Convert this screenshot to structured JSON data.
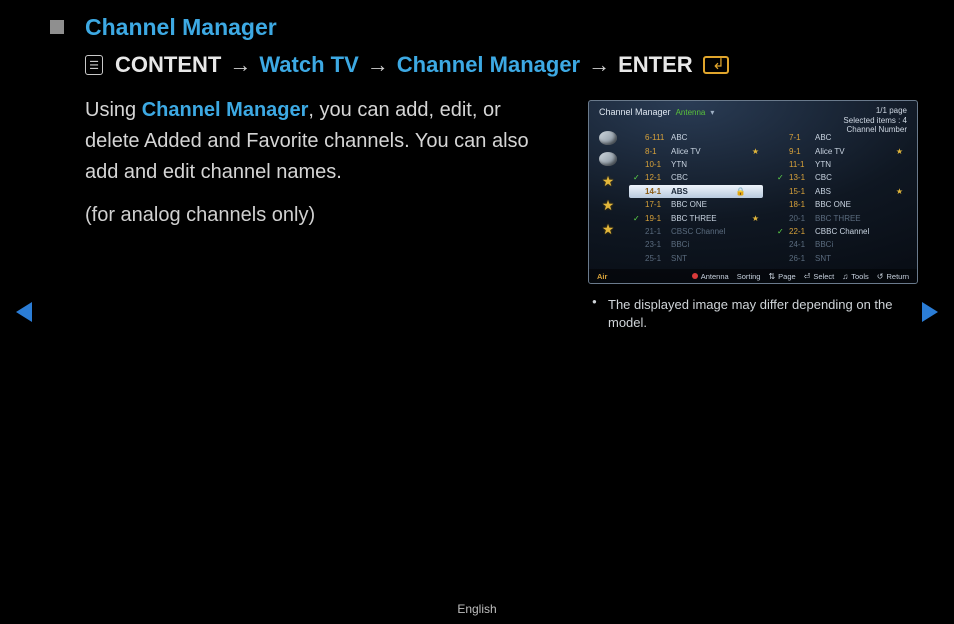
{
  "title": "Channel Manager",
  "breadcrumb": {
    "content": "CONTENT",
    "watch_tv": "Watch TV",
    "channel_manager": "Channel Manager",
    "enter": "ENTER",
    "arrow": "→"
  },
  "body": {
    "pre": "Using ",
    "cm": "Channel Manager",
    "post": ", you can add, edit, or delete Added and Favorite channels. You can also add and edit channel names."
  },
  "analog_note": "(for analog channels only)",
  "caption": "The displayed image may differ depending on the model.",
  "footer_lang": "English",
  "shot": {
    "header": {
      "title": "Channel Manager",
      "antenna": "Antenna",
      "page": "1/1 page",
      "selected": "Selected items : 4",
      "chnum": "Channel Number"
    },
    "left": [
      {
        "chk": false,
        "num": "6-111",
        "name": "ABC",
        "fav": false,
        "lock": false,
        "dim": false,
        "hl": false
      },
      {
        "chk": false,
        "num": "8-1",
        "name": "Alice TV",
        "fav": true,
        "lock": false,
        "dim": false,
        "hl": false
      },
      {
        "chk": false,
        "num": "10-1",
        "name": "YTN",
        "fav": false,
        "lock": false,
        "dim": false,
        "hl": false
      },
      {
        "chk": true,
        "num": "12-1",
        "name": "CBC",
        "fav": false,
        "lock": false,
        "dim": false,
        "hl": false
      },
      {
        "chk": false,
        "num": "14-1",
        "name": "ABS",
        "fav": false,
        "lock": true,
        "dim": false,
        "hl": true
      },
      {
        "chk": false,
        "num": "17-1",
        "name": "BBC ONE",
        "fav": false,
        "lock": false,
        "dim": false,
        "hl": false
      },
      {
        "chk": true,
        "num": "19-1",
        "name": "BBC THREE",
        "fav": true,
        "lock": false,
        "dim": false,
        "hl": false
      },
      {
        "chk": false,
        "num": "21-1",
        "name": "CBSC Channel",
        "fav": false,
        "lock": false,
        "dim": true,
        "hl": false
      },
      {
        "chk": false,
        "num": "23-1",
        "name": "BBCi",
        "fav": false,
        "lock": false,
        "dim": true,
        "hl": false
      },
      {
        "chk": false,
        "num": "25-1",
        "name": "SNT",
        "fav": false,
        "lock": false,
        "dim": true,
        "hl": false
      }
    ],
    "right": [
      {
        "chk": false,
        "num": "7-1",
        "name": "ABC",
        "fav": false,
        "lock": false,
        "dim": false,
        "hl": false
      },
      {
        "chk": false,
        "num": "9-1",
        "name": "Alice TV",
        "fav": true,
        "lock": false,
        "dim": false,
        "hl": false
      },
      {
        "chk": false,
        "num": "11-1",
        "name": "YTN",
        "fav": false,
        "lock": false,
        "dim": false,
        "hl": false
      },
      {
        "chk": true,
        "num": "13-1",
        "name": "CBC",
        "fav": false,
        "lock": false,
        "dim": false,
        "hl": false
      },
      {
        "chk": false,
        "num": "15-1",
        "name": "ABS",
        "fav": true,
        "lock": false,
        "dim": false,
        "hl": false
      },
      {
        "chk": false,
        "num": "18-1",
        "name": "BBC ONE",
        "fav": false,
        "lock": false,
        "dim": false,
        "hl": false
      },
      {
        "chk": false,
        "num": "20-1",
        "name": "BBC THREE",
        "fav": false,
        "lock": false,
        "dim": true,
        "hl": false
      },
      {
        "chk": true,
        "num": "22-1",
        "name": "CBBC Channel",
        "fav": false,
        "lock": false,
        "dim": false,
        "hl": false
      },
      {
        "chk": false,
        "num": "24-1",
        "name": "BBCi",
        "fav": false,
        "lock": false,
        "dim": true,
        "hl": false
      },
      {
        "chk": false,
        "num": "26-1",
        "name": "SNT",
        "fav": false,
        "lock": false,
        "dim": true,
        "hl": false
      }
    ],
    "footer": {
      "air": "Air",
      "antenna": "Antenna",
      "sorting": "Sorting",
      "page": "Page",
      "select": "Select",
      "tools": "Tools",
      "return": "Return"
    }
  }
}
